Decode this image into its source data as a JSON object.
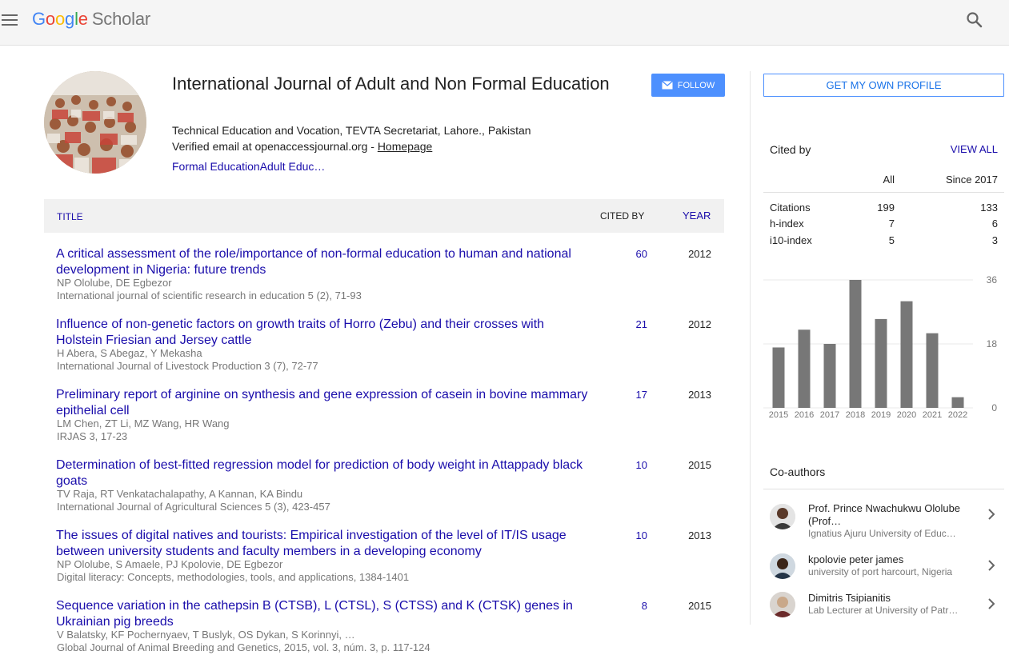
{
  "header": {
    "logo_google": [
      "G",
      "o",
      "o",
      "g",
      "l",
      "e"
    ],
    "logo_scholar": "Scholar"
  },
  "profile": {
    "name": "International Journal of Adult and Non Formal Education",
    "affiliation": "Technical Education and Vocation, TEVTA Secretariat, Lahore., Pakistan",
    "email_text": "Verified email at openaccessjournal.org - ",
    "homepage_label": "Homepage",
    "interests": "Formal EducationAdult Educ…",
    "follow_label": "FOLLOW"
  },
  "table": {
    "col_title": "TITLE",
    "col_cited": "CITED BY",
    "col_year": "YEAR",
    "rows": [
      {
        "title": "A critical assessment of the role/importance of non-formal education to human and national development in Nigeria: future trends",
        "authors": "NP Ololube, DE Egbezor",
        "venue": "International journal of scientific research in education 5 (2), 71-93",
        "cited": "60",
        "year": "2012"
      },
      {
        "title": "Influence of non-genetic factors on growth traits of Horro (Zebu) and their crosses with Holstein Friesian and Jersey cattle",
        "authors": "H Abera, S Abegaz, Y Mekasha",
        "venue": "International Journal of Livestock Production 3 (7), 72-77",
        "cited": "21",
        "year": "2012"
      },
      {
        "title": "Preliminary report of arginine on synthesis and gene expression of casein in bovine mammary epithelial cell",
        "authors": "LM Chen, ZT Li, MZ Wang, HR Wang",
        "venue": "IRJAS 3, 17-23",
        "cited": "17",
        "year": "2013"
      },
      {
        "title": "Determination of best-fitted regression model for prediction of body weight in Attappady black goats",
        "authors": "TV Raja, RT Venkatachalapathy, A Kannan, KA Bindu",
        "venue": "International Journal of Agricultural Sciences 5 (3), 423-457",
        "cited": "10",
        "year": "2015"
      },
      {
        "title": "The issues of digital natives and tourists: Empirical investigation of the level of IT/IS usage between university students and faculty members in a developing economy",
        "authors": "NP Ololube, S Amaele, PJ Kpolovie, DE Egbezor",
        "venue": "Digital literacy: Concepts, methodologies, tools, and applications, 1384-1401",
        "cited": "10",
        "year": "2013"
      },
      {
        "title": "Sequence variation in the cathepsin B (CTSB), L (CTSL), S (CTSS) and K (CTSK) genes in Ukrainian pig breeds",
        "authors": "V Balatsky, KF Pochernyaev, T Buslyk, OS Dykan, S Korinnyi, …",
        "venue": "Global Journal of Animal Breeding and Genetics, 2015, vol. 3, núm. 3, p. 117-124",
        "cited": "8",
        "year": "2015"
      }
    ]
  },
  "sidebar": {
    "get_profile_label": "GET MY OWN PROFILE",
    "cited_by_title": "Cited by",
    "view_all_label": "VIEW ALL",
    "col_all": "All",
    "col_since": "Since 2017",
    "metrics": [
      {
        "label": "Citations",
        "all": "199",
        "since": "133"
      },
      {
        "label": "h-index",
        "all": "7",
        "since": "6"
      },
      {
        "label": "i10-index",
        "all": "5",
        "since": "3"
      }
    ],
    "coauthors_title": "Co-authors",
    "coauthors": [
      {
        "name": "Prof. Prince Nwachukwu Ololube (Prof…",
        "affiliation": "Ignatius Ajuru University of Educ…"
      },
      {
        "name": "kpolovie peter james",
        "affiliation": "university of port harcourt, Nigeria"
      },
      {
        "name": "Dimitris Tsipianitis",
        "affiliation": "Lab Lecturer at University of Patr…"
      }
    ]
  },
  "chart_data": {
    "type": "bar",
    "categories": [
      "2015",
      "2016",
      "2017",
      "2018",
      "2019",
      "2020",
      "2021",
      "2022"
    ],
    "values": [
      17,
      22,
      18,
      36,
      25,
      30,
      21,
      3
    ],
    "y_ticks": [
      "36",
      "18",
      "0"
    ],
    "ylim": [
      0,
      36
    ],
    "grid": true,
    "bar_color": "#777777"
  },
  "colors": {
    "link": "#1a0dab",
    "accent": "#4d90fe",
    "header_bg": "#f5f5f5"
  }
}
